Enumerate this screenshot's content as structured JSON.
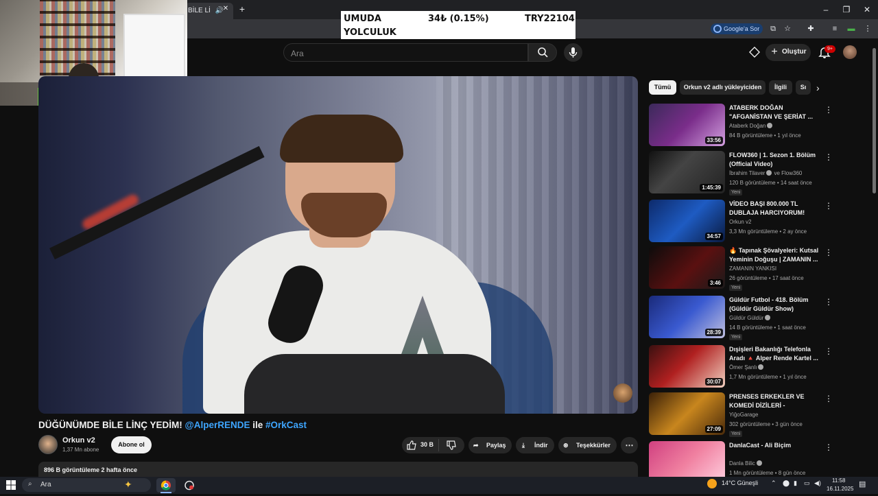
{
  "browser": {
    "tab_title": "BİLE Lİ",
    "new_tab_icon": "plus",
    "google_button": "Google'a Sor"
  },
  "ticker": {
    "name_line1": "UMUDA",
    "name_line2": "YOLCULUK",
    "change": "34₺ (0.15%)",
    "value": "TRY22104"
  },
  "header": {
    "search_placeholder": "Ara",
    "create_label": "Oluştur",
    "notifications_badge": "9+"
  },
  "video": {
    "title_main": "DÜĞÜNÜMDE BİLE LİNÇ YEDİM!",
    "title_mention": "@AlperRENDE",
    "title_joiner": "ile",
    "title_hashtag": "#OrkCast",
    "channel_name": "Orkun v2",
    "subscribers": "1,37 Mn abone",
    "subscribe_label": "Abone ol",
    "likes": "30 B",
    "share_label": "Paylaş",
    "download_label": "İndir",
    "thanks_label": "Teşekkürler",
    "views_and_date": "896 B görüntüleme  2 hafta önce"
  },
  "chips": [
    "Tümü",
    "Orkun v2 adlı yükleyiciden",
    "İlgili",
    "Sı"
  ],
  "recommendations": [
    {
      "title": "ATABERK DOĞAN \"AFGANİSTAN VE ŞERİAT ...",
      "channel": "Ataberk Doğan",
      "verified": true,
      "meta": "84 B görüntüleme • 1 yıl önce",
      "duration": "33:56",
      "new": "",
      "thumb": "linear-gradient(135deg,#3b2a5a,#7a2d8a 50%,#d3a0e0)"
    },
    {
      "title": "FLOW360 | 1. Sezon 1. Bölüm (Official Video)",
      "channel": "İbrahim Tilaver",
      "verified": true,
      "channel_extra": "ve Flow360",
      "meta": "120 B görüntüleme • 14 saat önce",
      "duration": "1:45:39",
      "new": "Yeni",
      "thumb": "linear-gradient(135deg,#111,#444 40%,#222)"
    },
    {
      "title": "VİDEO BAŞI 800.000 TL DUBLAJA HARCIYORUM! Ruhi...",
      "channel": "Orkun v2",
      "verified": false,
      "meta": "3,3 Mn görüntüleme • 2 ay önce",
      "duration": "34:57",
      "new": "",
      "thumb": "linear-gradient(135deg,#0d2a6b,#1e5bc2 50%,#0a1a40)"
    },
    {
      "title": "🔥 Tapınak Şövalyeleri: Kutsal Yeminin Doğuşu | ZAMANIN ...",
      "channel": "ZAMANIN YANKISI",
      "verified": false,
      "meta": "26 görüntüleme • 17 saat önce",
      "duration": "3:46",
      "new": "Yeni",
      "thumb": "linear-gradient(135deg,#0c0c0c,#5a1010 55%,#1a1a1a)"
    },
    {
      "title": "Güldür Futbol - 418. Bölüm (Güldür Güldür Show)",
      "channel": "Güldür Güldür",
      "verified": true,
      "meta": "14 B görüntüleme • 1 saat önce",
      "duration": "28:39",
      "new": "Yeni",
      "thumb": "linear-gradient(135deg,#1a2a7a,#3a5ad0 50%,#c0c0e0)"
    },
    {
      "title": "Dışişleri Bakanlığı Telefonla Aradı 🔺 Alper Rende Kartel ...",
      "channel": "Ömer Şanlı",
      "verified": true,
      "meta": "1,7 Mn görüntüleme • 1 yıl önce",
      "duration": "30:07",
      "new": "",
      "thumb": "linear-gradient(135deg,#3a1010,#b02020 45%,#f0d0c0)"
    },
    {
      "title": "PRENSES ERKEKLER VE KOMEDİ DİZİLERİ - LoudSessi...",
      "channel": "YiğoGarage",
      "verified": false,
      "meta": "302 görüntüleme • 3 gün önce",
      "duration": "27:09",
      "new": "Yeni",
      "thumb": "linear-gradient(135deg,#3a2008,#c8861e 50%,#4a2a0a)"
    },
    {
      "title": "DanlaCast - Ali Biçim",
      "channel": "Danla Bilic",
      "verified": true,
      "meta": "1 Mn görüntüleme • 8 gün önce",
      "duration": "",
      "new": "",
      "thumb": "linear-gradient(135deg,#d04080,#f080a0 50%,#ffd0e0)"
    }
  ],
  "taskbar": {
    "search_placeholder": "Ara",
    "weather": "14°C  Güneşli",
    "time": "11:58",
    "date": "16.11.2025"
  }
}
